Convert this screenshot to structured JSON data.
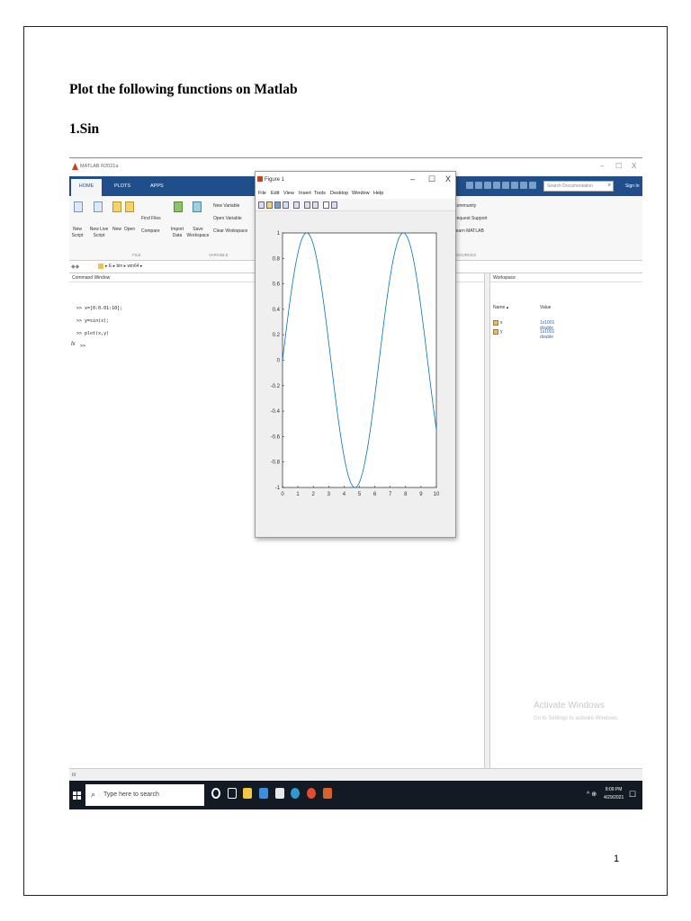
{
  "document": {
    "title": "Plot the following functions on Matlab",
    "section": "1.Sin",
    "page_number": "1"
  },
  "matlab": {
    "window_title": "MATLAB R2021a",
    "tabs": [
      "HOME",
      "PLOTS",
      "APPS"
    ],
    "search_placeholder": "Search Documentation",
    "sign_in": "Sign In",
    "ribbon": {
      "new_script": "New Script",
      "new_live_script": "New Live Script",
      "new": "New",
      "open": "Open",
      "find_files": "Find Files",
      "compare": "Compare",
      "import_data": "Import Data",
      "save_workspace": "Save Workspace",
      "new_variable": "New Variable",
      "open_variable": "Open Variable",
      "clear_workspace": "Clear Workspace",
      "community": "Community",
      "request_support": "Request Support",
      "learn_matlab": "Learn MATLAB",
      "section_file": "FILE",
      "section_variable": "VARIABLE",
      "section_resources": "SOURCES"
    },
    "address_path": "▸ E ▸ bin ▸ win64 ▸",
    "command_window": {
      "title": "Command Window",
      "lines": [
        ">> x=[0:0.01:10];",
        ">> y=sin(x);",
        ">> plot(x,y)"
      ],
      "prompt": ">>",
      "fx": "fx"
    },
    "workspace": {
      "title": "Workspace",
      "col_name": "Name ▴",
      "col_value": "Value",
      "rows": [
        {
          "name": "x",
          "value": "1x1001 double"
        },
        {
          "name": "y",
          "value": "1x1001 double"
        }
      ],
      "activate_title": "Activate Windows",
      "activate_sub": "Go to Settings to activate Windows."
    },
    "status": "III"
  },
  "figure": {
    "title": "Figure 1",
    "menu": [
      "File",
      "Edit",
      "View",
      "Insert",
      "Tools",
      "Desktop",
      "Window",
      "Help"
    ]
  },
  "taskbar": {
    "search_placeholder": "Type here to search",
    "time": "8:09 PM",
    "date": "4/29/2021"
  },
  "chart_data": {
    "type": "line",
    "title": "",
    "xlabel": "",
    "ylabel": "",
    "xlim": [
      0,
      10
    ],
    "ylim": [
      -1,
      1
    ],
    "xticks": [
      0,
      1,
      2,
      3,
      4,
      5,
      6,
      7,
      8,
      9,
      10
    ],
    "yticks": [
      -1,
      -0.8,
      -0.6,
      -0.4,
      -0.2,
      0,
      0.2,
      0.4,
      0.6,
      0.8,
      1
    ],
    "series": [
      {
        "function": "sin(x)",
        "x_start": 0,
        "x_end": 10,
        "x_step": 0.01,
        "color": "#0072bd"
      }
    ],
    "grid": false
  }
}
